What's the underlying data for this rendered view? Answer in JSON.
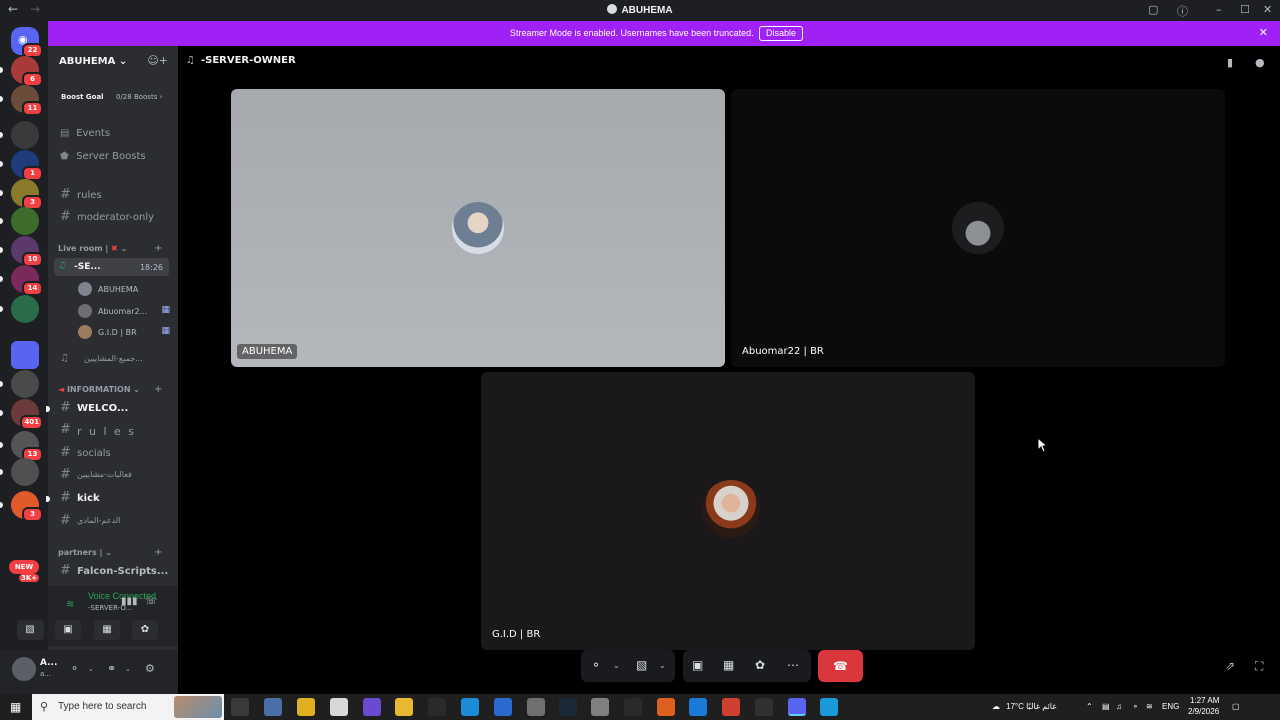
{
  "window": {
    "title": "ABUHEMA"
  },
  "streamer_banner": {
    "message": "Streamer Mode is enabled. Usernames have been truncated.",
    "button": "Disable"
  },
  "rail": {
    "dm_badge": "22",
    "servers": [
      {
        "badge": "6",
        "color": "#a83a3a"
      },
      {
        "badge": "11",
        "color": "#6b4b3a"
      },
      {
        "badge": "",
        "color": "#3a3a3a"
      },
      {
        "badge": "1",
        "color": "#1f3d7a"
      },
      {
        "badge": "3",
        "color": "#8a7a2a"
      },
      {
        "badge": "",
        "color": "#3d6b2a"
      },
      {
        "badge": "10",
        "color": "#5a3a6b"
      },
      {
        "badge": "14",
        "color": "#7a2a5a"
      },
      {
        "badge": "",
        "color": "#2a6b4a"
      },
      {
        "badge": "",
        "color": "#5865f2"
      },
      {
        "badge": "",
        "color": "#4a4a4a"
      },
      {
        "badge": "401",
        "color": "#6b3a3a"
      },
      {
        "badge": "13",
        "color": "#555555"
      },
      {
        "badge": "",
        "color": "#505050"
      },
      {
        "badge": "3",
        "color": "#e05a2a"
      }
    ],
    "new_badge": "NEW",
    "new_count": "3K+"
  },
  "server": {
    "name": "ABUHEMA",
    "boost_goal": "Boost Goal",
    "boost_count": "0/28 Boosts"
  },
  "nav": {
    "events": "Events",
    "server_boosts": "Server Boosts"
  },
  "channels_top": [
    {
      "label": "rules"
    },
    {
      "label": "moderator-only"
    }
  ],
  "categories": {
    "live_room": "Live room | ",
    "information": "INFORMATION",
    "partners": "partners | "
  },
  "voice_channel": {
    "label": "-SE...",
    "time": "18:26"
  },
  "voice_users": [
    {
      "name": "ABUHEMA",
      "pad": false
    },
    {
      "name": "Abuomar2...",
      "pad": true
    },
    {
      "name": "G.I.D | BR",
      "pad": true
    }
  ],
  "voice_channel2": {
    "label": "جميع-المشاييين..."
  },
  "info_channels": [
    {
      "label": "WELCO...",
      "bold": true,
      "unread": true
    },
    {
      "label": "r u l e s",
      "bold": false,
      "unread": false
    },
    {
      "label": "socials",
      "bold": false,
      "unread": false
    },
    {
      "label": "فعاليات-مشاييين",
      "bold": false,
      "unread": false
    },
    {
      "label": "kick",
      "bold": true,
      "unread": true
    },
    {
      "label": "الدعم-المادي",
      "bold": false,
      "unread": false
    }
  ],
  "partner_channel": {
    "label": "Falcon-Scripts..."
  },
  "voice_panel": {
    "status": "Voice Connected",
    "subtitle": "-SERVER-O..."
  },
  "user_panel": {
    "name": "A...",
    "status": "a..."
  },
  "stage": {
    "channel_title": "-SERVER-OWNER",
    "tiles": [
      {
        "name": "ABUHEMA"
      },
      {
        "name": "Abuomar22 | BR"
      },
      {
        "name": "G.I.D | BR"
      }
    ]
  },
  "taskbar": {
    "search_placeholder": "Type here to search",
    "weather": "17°C  غائم غالبًا",
    "lang": "ENG",
    "time": "1:27 AM",
    "date": "2/9/2026"
  },
  "colors": {
    "streamer": "#a021f5",
    "hangup": "#da373c",
    "voice_green": "#23a55a"
  }
}
